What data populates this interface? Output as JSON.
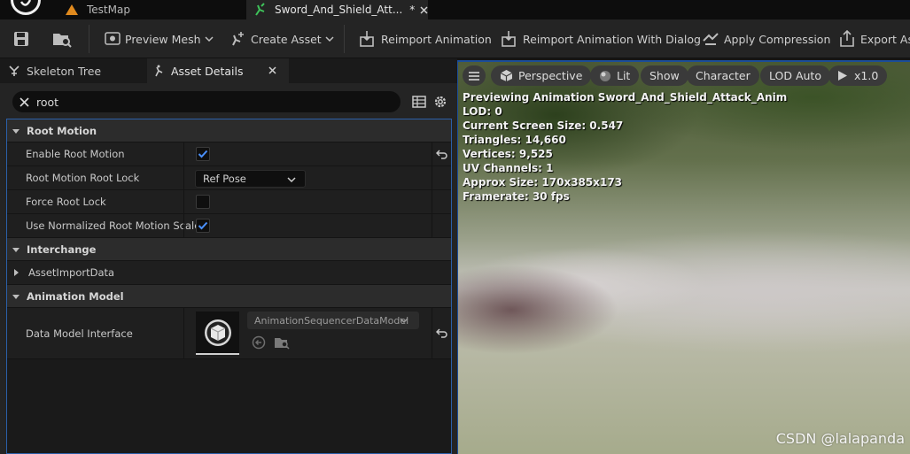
{
  "tabs": [
    {
      "label": "TestMap"
    },
    {
      "label": "Sword_And_Shield_Att...",
      "modified": "*"
    }
  ],
  "toolbar": {
    "preview_mesh": "Preview Mesh",
    "create_asset": "Create Asset",
    "reimport_animation": "Reimport Animation",
    "reimport_with_dialog": "Reimport Animation With Dialog",
    "apply_compression": "Apply Compression",
    "export_asset": "Export As"
  },
  "panel": {
    "tab_skeleton": "Skeleton Tree",
    "tab_details": "Asset Details",
    "search_value": "root"
  },
  "categories": {
    "root_motion": "Root Motion",
    "interchange": "Interchange",
    "animation_model": "Animation Model"
  },
  "properties": {
    "enable_root_motion": {
      "label": "Enable Root Motion",
      "checked": true
    },
    "root_lock": {
      "label": "Root Motion Root Lock",
      "value": "Ref Pose"
    },
    "force_root_lock": {
      "label": "Force Root Lock",
      "checked": false
    },
    "normalized_scale": {
      "label": "Use Normalized Root Motion Scale",
      "checked": true
    },
    "asset_import_data": {
      "label": "AssetImportData"
    },
    "data_model": {
      "label": "Data Model Interface",
      "value": "AnimationSequencerDataModel"
    }
  },
  "viewport": {
    "perspective": "Perspective",
    "lit": "Lit",
    "show": "Show",
    "character": "Character",
    "lod": "LOD Auto",
    "speed": "x1.0",
    "stats": [
      "Previewing Animation Sword_And_Shield_Attack_Anim",
      "LOD: 0",
      "Current Screen Size: 0.547",
      "Triangles: 14,660",
      "Vertices: 9,525",
      "UV Channels: 1",
      "Approx Size: 170x385x173",
      "Framerate: 30 fps"
    ],
    "watermark": "CSDN @lalapanda"
  },
  "colors": {
    "accent": "#2b6dd6",
    "checkbox": "#4a90ff",
    "selection_border": "#2b5fa8"
  }
}
